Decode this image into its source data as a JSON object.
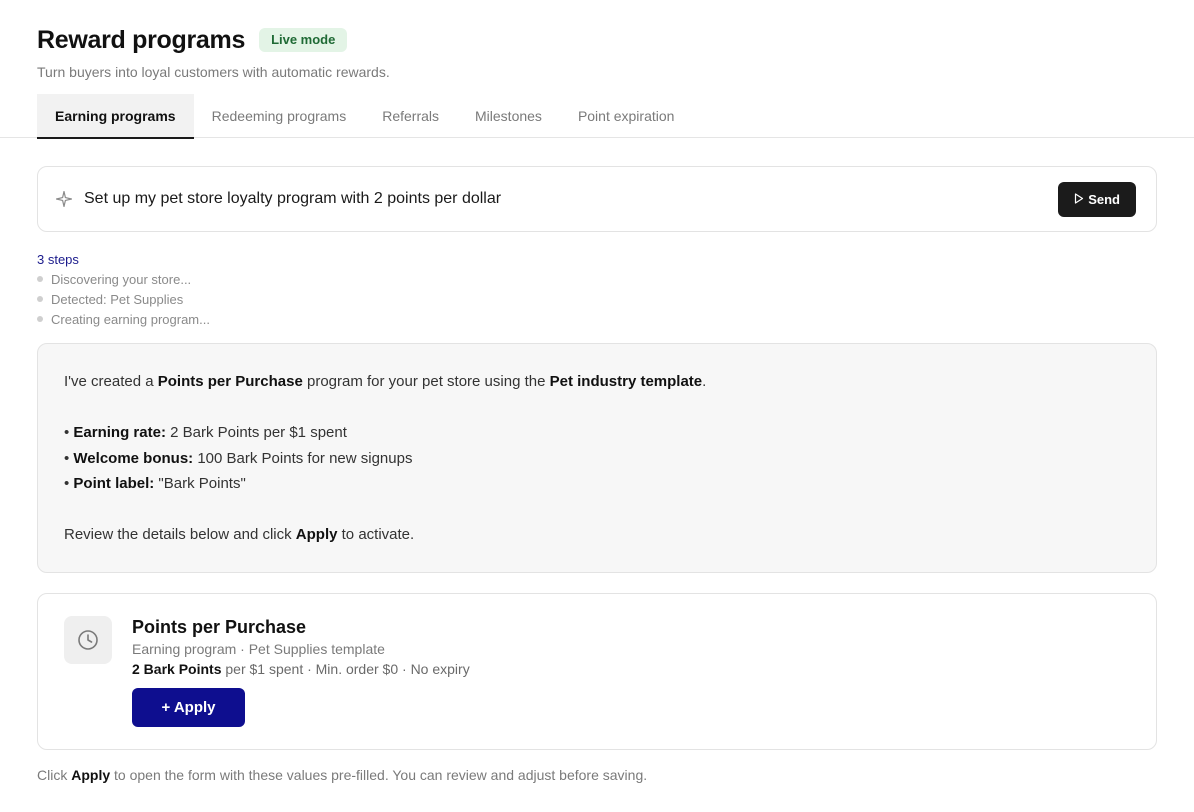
{
  "header": {
    "title": "Reward programs",
    "badge": "Live mode",
    "subtitle": "Turn buyers into loyal customers with automatic rewards."
  },
  "tabs": [
    {
      "label": "Earning programs",
      "active": true
    },
    {
      "label": "Redeeming programs",
      "active": false
    },
    {
      "label": "Referrals",
      "active": false
    },
    {
      "label": "Milestones",
      "active": false
    },
    {
      "label": "Point expiration",
      "active": false
    }
  ],
  "prompt": {
    "icon": "sparkle-icon",
    "text": "Set up my pet store loyalty program with 2 points per dollar",
    "send_label": "Send"
  },
  "steps": {
    "count_label": "3 steps",
    "items": [
      "Discovering your store...",
      "Detected: Pet Supplies",
      "Creating earning program..."
    ]
  },
  "message": {
    "intro_1": "I've created a ",
    "intro_bold_1": "Points per Purchase",
    "intro_2": " program for your pet store using the ",
    "intro_bold_2": "Pet industry template",
    "intro_3": ".",
    "bullets": [
      {
        "label": "Earning rate:",
        "value": " 2 Bark Points per $1 spent"
      },
      {
        "label": "Welcome bonus:",
        "value": " 100 Bark Points for new signups"
      },
      {
        "label": "Point label:",
        "value": " \"Bark Points\""
      }
    ],
    "outro_1": "Review the details below and click ",
    "outro_bold": "Apply",
    "outro_2": " to activate."
  },
  "card": {
    "icon": "clock-icon",
    "title": "Points per Purchase",
    "subtitle": "Earning program · Pet Supplies template",
    "detail_bold": "2 Bark Points",
    "detail_rest": " per $1 spent · Min. order $0 · No expiry",
    "apply_label": "+ Apply"
  },
  "footer": {
    "part_1": "Click ",
    "bold": "Apply",
    "part_2": " to open the form with these values pre-filled. You can review and adjust before saving."
  },
  "colors": {
    "accent": "#0e0e8f",
    "badge_bg": "#e3f4e6",
    "badge_text": "#1f6a35",
    "send_bg": "#1b1b1b"
  }
}
